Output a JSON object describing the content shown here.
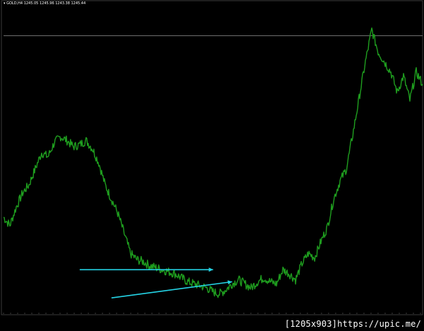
{
  "header": {
    "symbol": "GOLD,H4",
    "ohlc": "1245.05 1245.96 1243.38 1245.44"
  },
  "watermark": "[1205x903]https://upic.me/",
  "colors": {
    "background": "#000000",
    "price": "#1f9e1f",
    "grid": "#3a3a3a",
    "trendline": "#25d4e6",
    "hline": "#6e6e6e",
    "text": "#ffffff"
  },
  "chart_data": {
    "type": "line",
    "grid": false,
    "hline": 1288,
    "ylim": [
      1150,
      1305
    ],
    "series": [
      {
        "values": [
          1198,
          1194,
          1203,
          1210,
          1214,
          1222,
          1230,
          1228,
          1235,
          1238,
          1236,
          1233,
          1234,
          1236,
          1232,
          1225,
          1214,
          1207,
          1200,
          1190,
          1180,
          1177,
          1176,
          1174,
          1173,
          1172,
          1171,
          1170,
          1168,
          1166,
          1165,
          1164,
          1163,
          1161,
          1160,
          1162,
          1165,
          1167,
          1165,
          1163,
          1166,
          1168,
          1166,
          1165,
          1172,
          1170,
          1167,
          1175,
          1180,
          1178,
          1186,
          1193,
          1207,
          1216,
          1222,
          1239,
          1257,
          1275,
          1291,
          1280,
          1275,
          1270,
          1260,
          1268,
          1256,
          1270,
          1264
        ]
      }
    ],
    "annotations": [
      {
        "type": "arrow",
        "from": [
          12,
          1172
        ],
        "to": [
          33,
          1172
        ]
      },
      {
        "type": "arrow",
        "from": [
          17,
          1158
        ],
        "to": [
          36,
          1166
        ]
      }
    ]
  }
}
